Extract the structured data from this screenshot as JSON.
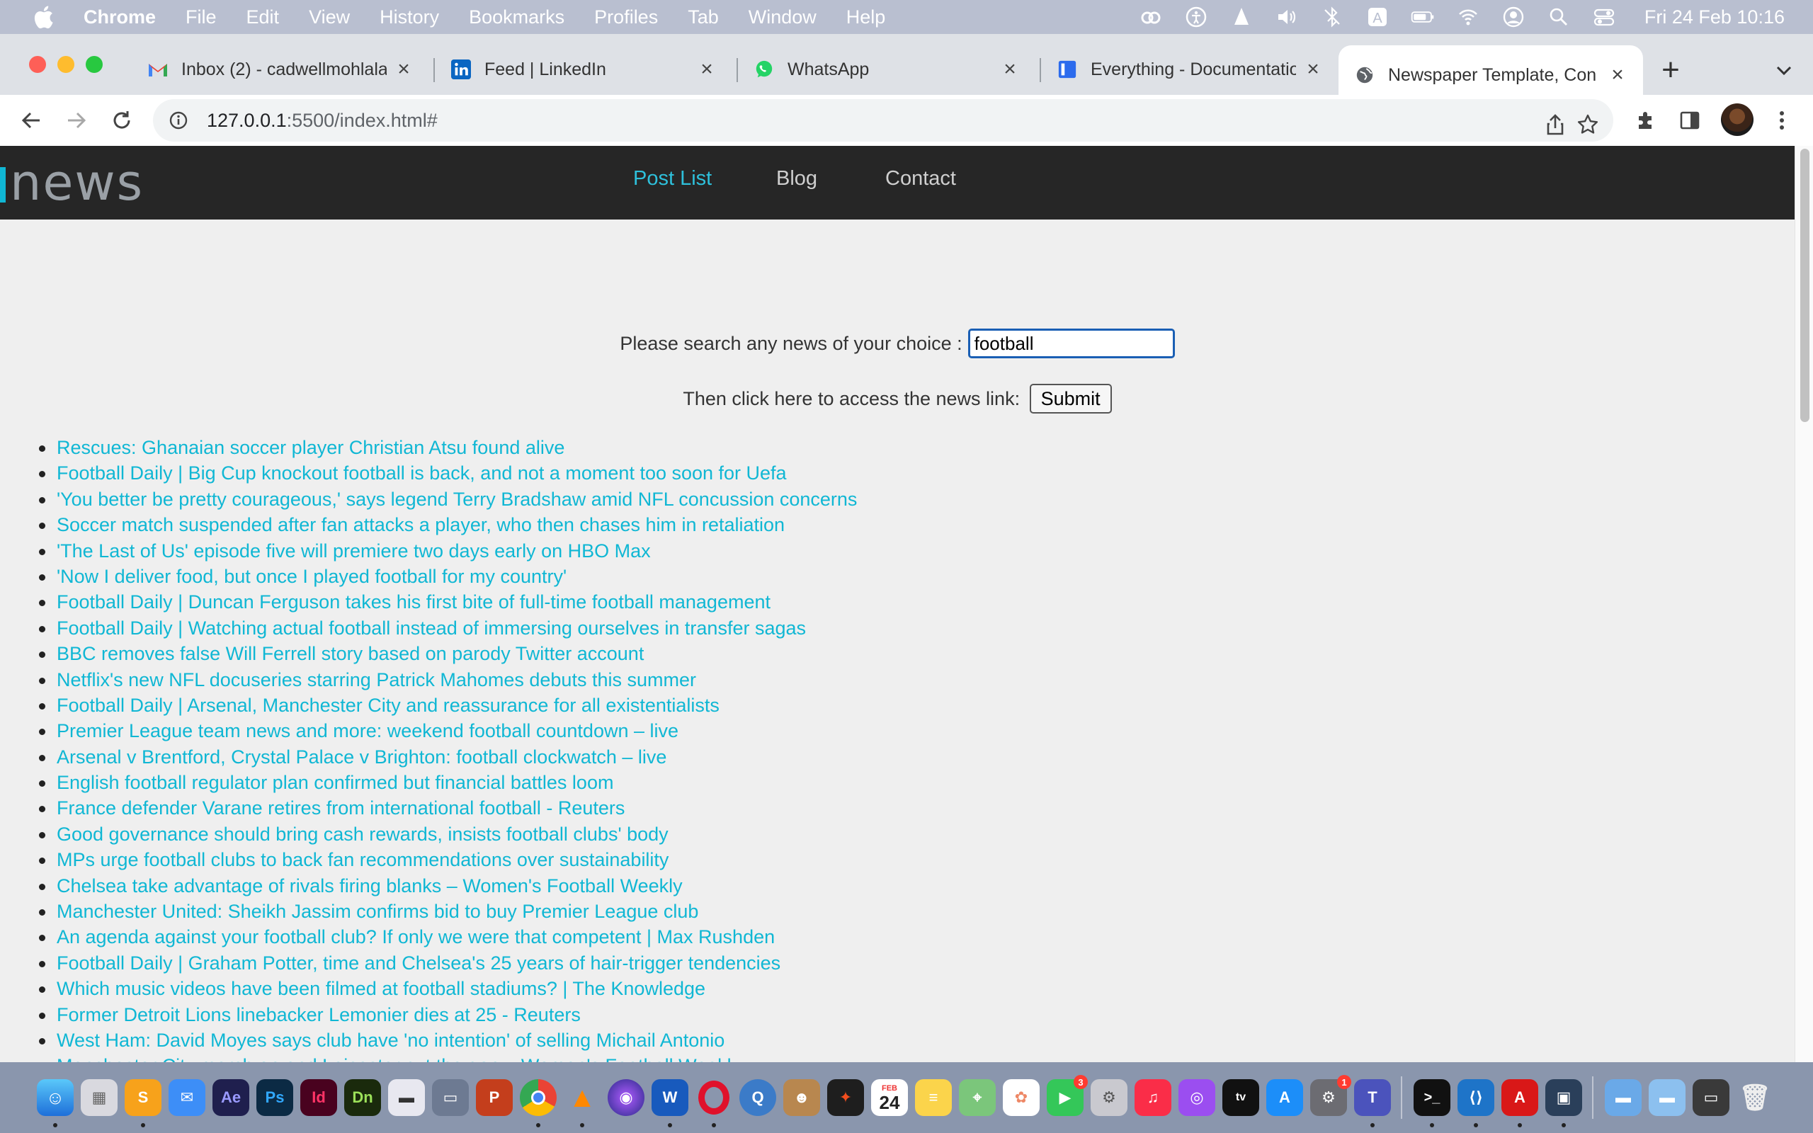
{
  "menubar": {
    "app_name": "Chrome",
    "items": [
      "File",
      "Edit",
      "View",
      "History",
      "Bookmarks",
      "Profiles",
      "Tab",
      "Window",
      "Help"
    ],
    "clock": "Fri 24 Feb  10:16"
  },
  "tabs": [
    {
      "title": "Inbox (2) - cadwellmohlala",
      "icon": "gmail-icon",
      "close": "×"
    },
    {
      "title": "Feed | LinkedIn",
      "icon": "linkedin-icon",
      "close": "×"
    },
    {
      "title": "WhatsApp",
      "icon": "whatsapp-icon",
      "close": "×"
    },
    {
      "title": "Everything - Documentation",
      "icon": "document-icon",
      "close": "×"
    },
    {
      "title": "Newspaper Template, Con",
      "icon": "globe-icon",
      "close": "×"
    }
  ],
  "new_tab_label": "+",
  "address_bar": {
    "host": "127.0.0.1",
    "rest": ":5500/index.html#"
  },
  "site": {
    "logo_text": "news",
    "nav": [
      "Post List",
      "Blog",
      "Contact"
    ],
    "active_nav": "Post List"
  },
  "search": {
    "label": "Please search any news of your choice :",
    "value": "football",
    "submit_label": "Then click here to access the news link:",
    "submit_button": "Submit"
  },
  "news": [
    "Rescues: Ghanaian soccer player Christian Atsu found alive",
    "Football Daily | Big Cup knockout football is back, and not a moment too soon for Uefa",
    "'You better be pretty courageous,' says legend Terry Bradshaw amid NFL concussion concerns",
    "Soccer match suspended after fan attacks a player, who then chases him in retaliation",
    "'The Last of Us' episode five will premiere two days early on HBO Max",
    "'Now I deliver food, but once I played football for my country'",
    "Football Daily | Duncan Ferguson takes his first bite of full-time football management",
    "Football Daily | Watching actual football instead of immersing ourselves in transfer sagas",
    "BBC removes false Will Ferrell story based on parody Twitter account",
    "Netflix's new NFL docuseries starring Patrick Mahomes debuts this summer",
    "Football Daily | Arsenal, Manchester City and reassurance for all existentialists",
    "Premier League team news and more: weekend football countdown – live",
    "Arsenal v Brentford, Crystal Palace v Brighton: football clockwatch – live",
    "English football regulator plan confirmed but financial battles loom",
    "France defender Varane retires from international football - Reuters",
    "Good governance should bring cash rewards, insists football clubs' body",
    "MPs urge football clubs to back fan recommendations over sustainability",
    "Chelsea take advantage of rivals firing blanks – Women's Football Weekly",
    "Manchester United: Sheikh Jassim confirms bid to buy Premier League club",
    "An agenda against your football club? If only we were that competent | Max Rushden",
    "Football Daily | Graham Potter, time and Chelsea's 25 years of hair-trigger tendencies",
    "Which music videos have been filmed at football stadiums? | The Knowledge",
    "Former Detroit Lions linebacker Lemonier dies at 25 - Reuters",
    "West Ham: David Moyes says club have 'no intention' of selling Michail Antonio",
    "Manchester City march on and Leicester cut the gap – Women's Football Weekly"
  ],
  "dock": {
    "calendar_day": "24",
    "calendar_month": "FEB",
    "facetime_badge": "3",
    "settings_badge": "1"
  },
  "colors": {
    "accent": "#10b7d4",
    "nav_bg": "#262626",
    "page_bg": "#efefef"
  }
}
